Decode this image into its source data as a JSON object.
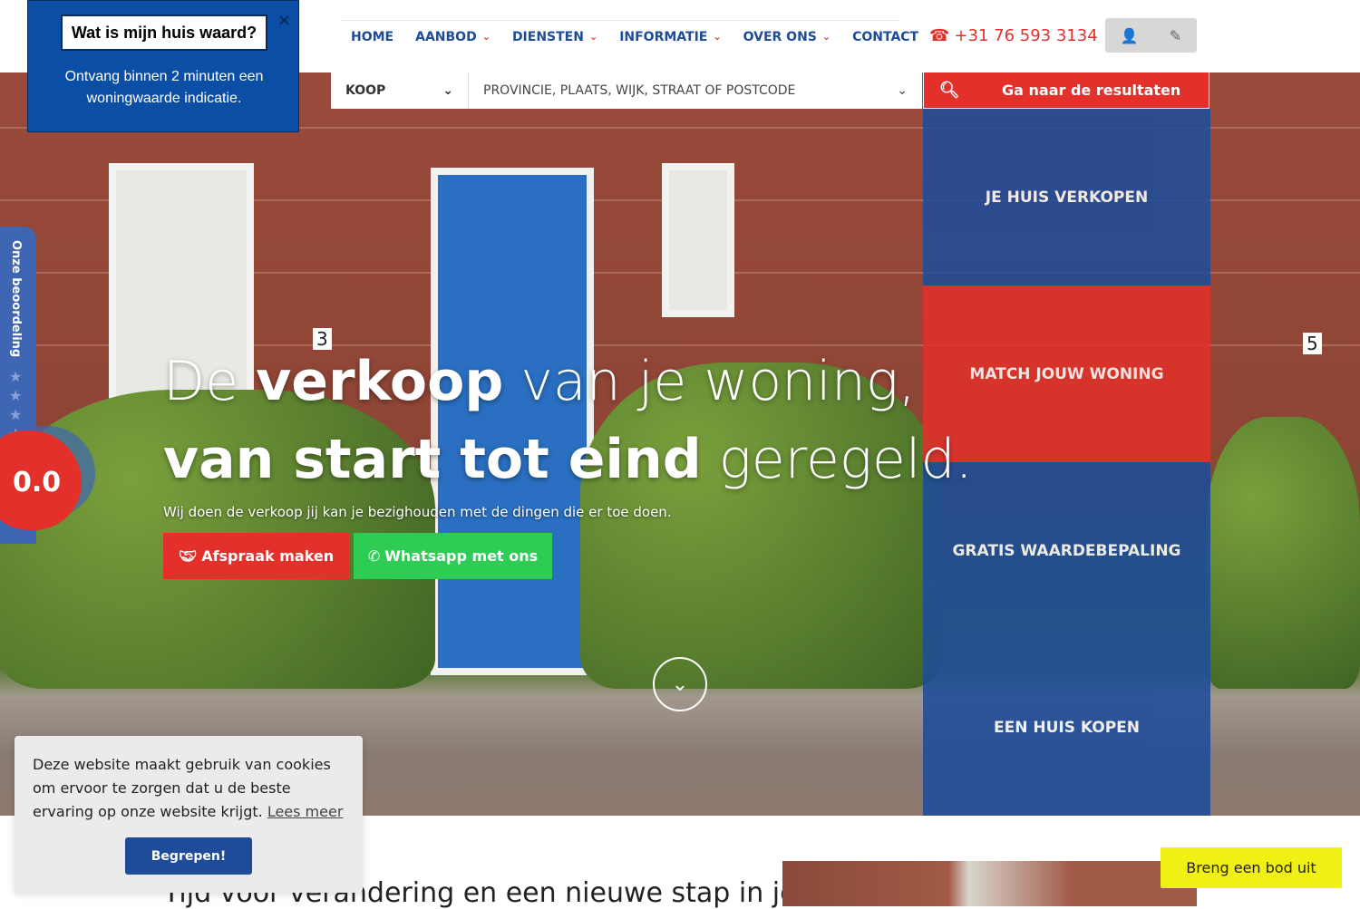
{
  "nav": {
    "items": [
      {
        "label": "HOME",
        "dropdown": false
      },
      {
        "label": "AANBOD",
        "dropdown": true
      },
      {
        "label": "DIENSTEN",
        "dropdown": true
      },
      {
        "label": "INFORMATIE",
        "dropdown": true
      },
      {
        "label": "OVER ONS",
        "dropdown": true
      },
      {
        "label": "CONTACT",
        "dropdown": false
      }
    ],
    "phone": "+31 76 593 3134"
  },
  "search": {
    "type": "KOOP",
    "location_placeholder": "PROVINCIE, PLAATS, WIJK, STRAAT OF POSTCODE",
    "submit": "Ga naar de resultaten"
  },
  "tiles": [
    {
      "label": "JE HUIS VERKOPEN",
      "color": "#1e4c9a"
    },
    {
      "label": "MATCH JOUW WONING",
      "color": "#e3302a"
    },
    {
      "label": "GRATIS WAARDEBEPALING",
      "color": "#1e4c9a"
    },
    {
      "label": "EEN HUIS KOPEN",
      "color": "#1e4c9a"
    }
  ],
  "hero": {
    "title_1_light": "De ",
    "title_1_bold": "verkoop",
    "title_1_rest": " van je woning,",
    "title_2_bold": "van start tot eind",
    "title_2_rest": " geregeld.",
    "subtitle": "Wij doen de verkoop jij kan je bezighouden met de dingen die er toe doen.",
    "appointment": "Afspraak maken",
    "whatsapp": "Whatsapp met ons",
    "house_number_left": "3",
    "house_number_right": "5"
  },
  "popup": {
    "title": "Wat is mijn huis waard?",
    "text": "Ontvang binnen 2 minuten een woningwaarde indicatie.",
    "close": "×"
  },
  "rating": {
    "label": "Onze beoordeling",
    "score": "0.0",
    "stars": 5
  },
  "cookie": {
    "message": "Deze website maakt gebruik van cookies om ervoor te zorgen dat u de beste ervaring op onze website krijgt.",
    "link": "Lees meer",
    "accept": "Begrepen!"
  },
  "section": {
    "title": "Tijd voor verandering en een nieuwe stap in je"
  },
  "bid_button": "Breng een bod uit",
  "colors": {
    "brand_blue": "#1e4c9a",
    "brand_red": "#e3302a",
    "whatsapp_green": "#2ecc55",
    "bid_yellow": "#f0f015"
  }
}
